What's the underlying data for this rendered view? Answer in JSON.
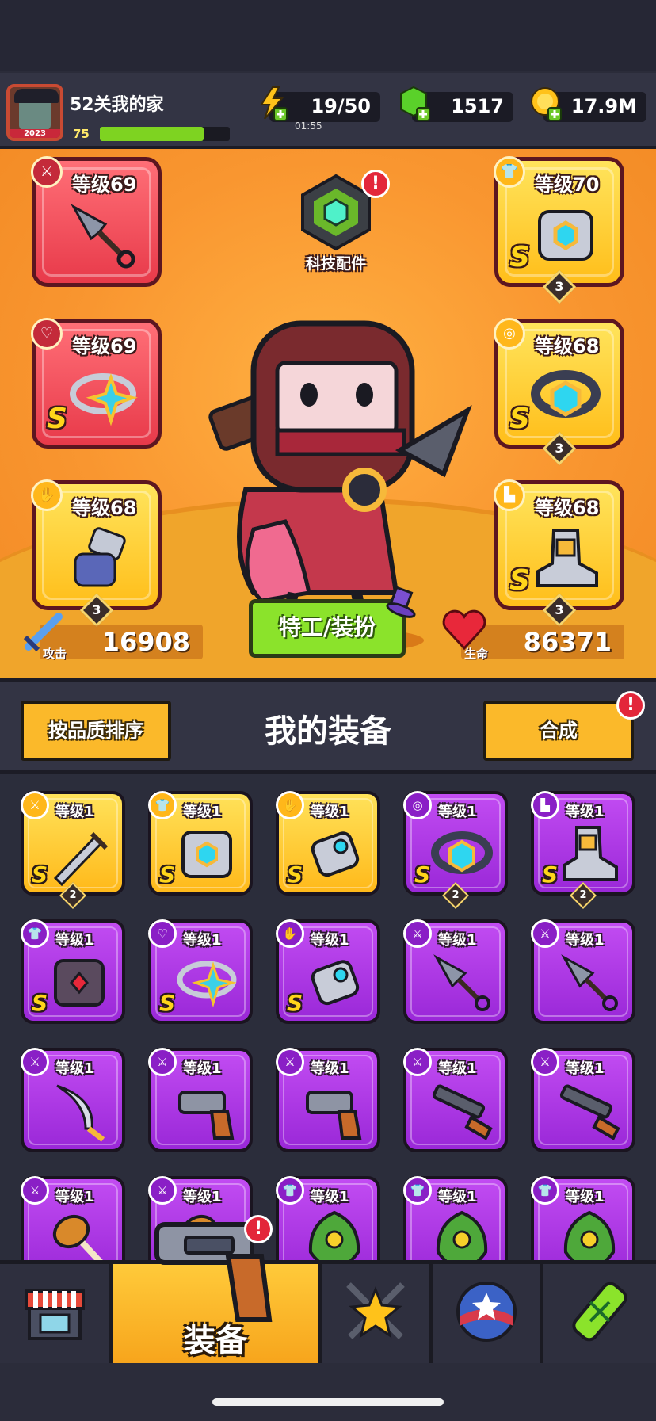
{
  "player": {
    "name": "52关我的家",
    "level": "75",
    "avatar_year": "2023",
    "xp_fraction": 0.8
  },
  "resources": {
    "energy": {
      "value": "19/50",
      "timer": "01:55",
      "icon": "lightning-plus-icon"
    },
    "gems": {
      "value": "1517",
      "icon": "green-gem-plus-icon"
    },
    "coins": {
      "value": "17.9M",
      "icon": "gold-coin-plus-icon"
    }
  },
  "tech_parts": {
    "label": "科技配件",
    "badge": "!"
  },
  "gear_left": [
    {
      "level": "等级69",
      "rank": "",
      "stars": "",
      "type_icon": "weapon-icon",
      "item": "kunai",
      "color": "red"
    },
    {
      "level": "等级69",
      "rank": "S",
      "stars": "",
      "type_icon": "necklace-icon",
      "item": "star-ring",
      "color": "red"
    },
    {
      "level": "等级68",
      "rank": "",
      "stars": "3",
      "type_icon": "glove-icon",
      "item": "gauntlet",
      "color": "gold"
    }
  ],
  "gear_right": [
    {
      "level": "等级70",
      "rank": "S",
      "stars": "3",
      "type_icon": "armor-icon",
      "item": "mech-armor",
      "color": "gold"
    },
    {
      "level": "等级68",
      "rank": "S",
      "stars": "3",
      "type_icon": "belt-icon",
      "item": "hex-belt",
      "color": "gold"
    },
    {
      "level": "等级68",
      "rank": "S",
      "stars": "3",
      "type_icon": "boot-icon",
      "item": "mech-boot",
      "color": "gold"
    }
  ],
  "stats": {
    "attack": {
      "label": "攻击",
      "value": "16908"
    },
    "life": {
      "label": "生命",
      "value": "86371"
    }
  },
  "agent_button": "特工/装扮",
  "equipment": {
    "title": "我的装备",
    "sort_label": "按品质排序",
    "merge_label": "合成",
    "merge_badge": "!"
  },
  "inventory": [
    {
      "level": "等级1",
      "rank": "S",
      "stars": "2",
      "color": "gold",
      "type": "weapon",
      "item": "sword"
    },
    {
      "level": "等级1",
      "rank": "S",
      "stars": "",
      "color": "gold",
      "type": "armor",
      "item": "mech-armor"
    },
    {
      "level": "等级1",
      "rank": "S",
      "stars": "",
      "color": "gold",
      "type": "glove",
      "item": "gauntlet"
    },
    {
      "level": "等级1",
      "rank": "S",
      "stars": "2",
      "color": "purple",
      "type": "belt",
      "item": "hex-belt"
    },
    {
      "level": "等级1",
      "rank": "S",
      "stars": "2",
      "color": "purple",
      "type": "boot",
      "item": "mech-boot"
    },
    {
      "level": "等级1",
      "rank": "S",
      "stars": "",
      "color": "purple",
      "type": "armor",
      "item": "dark-armor"
    },
    {
      "level": "等级1",
      "rank": "S",
      "stars": "",
      "color": "purple",
      "type": "necklace",
      "item": "star-ring"
    },
    {
      "level": "等级1",
      "rank": "S",
      "stars": "",
      "color": "purple",
      "type": "glove",
      "item": "gauntlet"
    },
    {
      "level": "等级1",
      "rank": "",
      "stars": "",
      "color": "purple",
      "type": "weapon",
      "item": "kunai"
    },
    {
      "level": "等级1",
      "rank": "",
      "stars": "",
      "color": "purple",
      "type": "weapon",
      "item": "kunai"
    },
    {
      "level": "等级1",
      "rank": "",
      "stars": "",
      "color": "purple",
      "type": "weapon",
      "item": "scimitar"
    },
    {
      "level": "等级1",
      "rank": "",
      "stars": "",
      "color": "purple",
      "type": "weapon",
      "item": "revolver"
    },
    {
      "level": "等级1",
      "rank": "",
      "stars": "",
      "color": "purple",
      "type": "weapon",
      "item": "revolver"
    },
    {
      "level": "等级1",
      "rank": "",
      "stars": "",
      "color": "purple",
      "type": "weapon",
      "item": "shotgun"
    },
    {
      "level": "等级1",
      "rank": "",
      "stars": "",
      "color": "purple",
      "type": "weapon",
      "item": "shotgun"
    },
    {
      "level": "等级1",
      "rank": "",
      "stars": "",
      "color": "purple",
      "type": "weapon",
      "item": "drumstick"
    },
    {
      "level": "等级1",
      "rank": "",
      "stars": "",
      "color": "purple",
      "type": "weapon",
      "item": "drumstick"
    },
    {
      "level": "等级1",
      "rank": "",
      "stars": "",
      "color": "purple",
      "type": "armor",
      "item": "leaf-armor"
    },
    {
      "level": "等级1",
      "rank": "",
      "stars": "",
      "color": "purple",
      "type": "armor",
      "item": "leaf-armor"
    },
    {
      "level": "等级1",
      "rank": "",
      "stars": "",
      "color": "purple",
      "type": "armor",
      "item": "leaf-armor"
    }
  ],
  "nav": [
    {
      "name": "shop",
      "label": "",
      "icon": "shop-icon",
      "active": false
    },
    {
      "name": "equipment",
      "label": "装备",
      "icon": "revolver-icon",
      "active": true,
      "badge": "!"
    },
    {
      "name": "skills",
      "label": "",
      "icon": "crossed-swords-star-icon",
      "active": false
    },
    {
      "name": "talents",
      "label": "",
      "icon": "star-ball-icon",
      "active": false
    },
    {
      "name": "evolve",
      "label": "",
      "icon": "dna-tube-icon",
      "active": false
    }
  ]
}
